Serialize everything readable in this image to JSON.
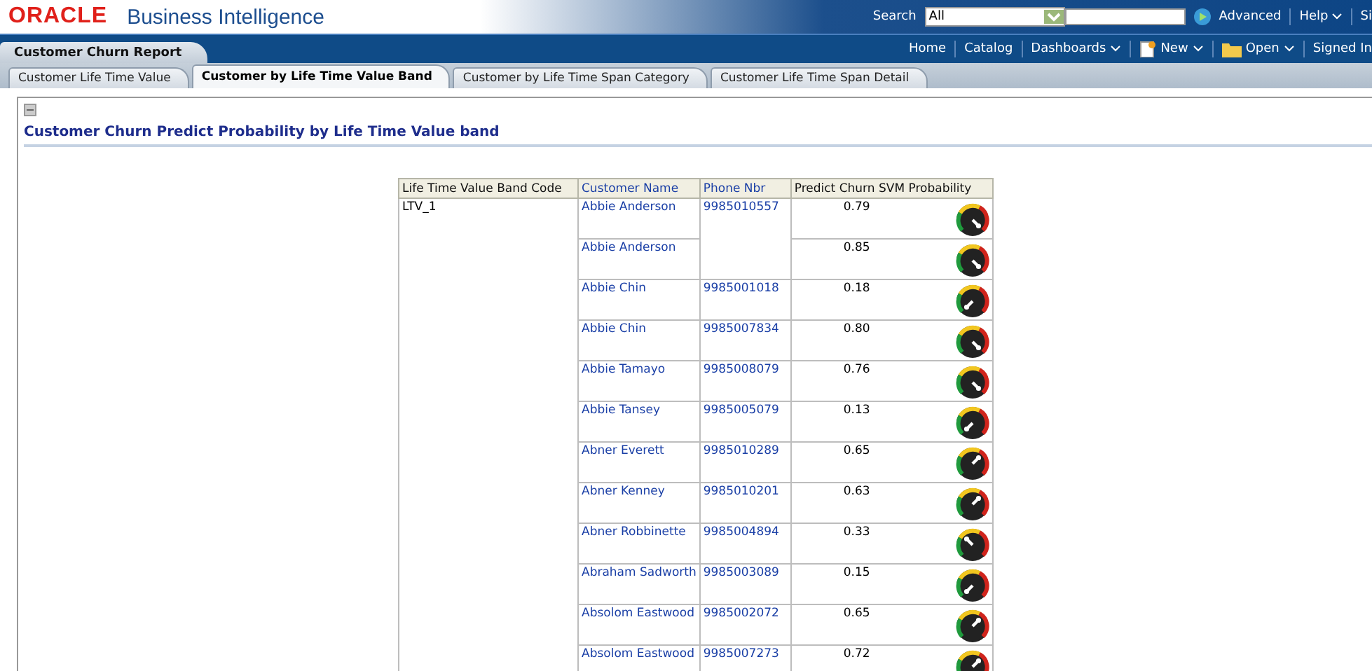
{
  "brand": {
    "logo": "ORACLE",
    "product": "Business Intelligence"
  },
  "search": {
    "label": "Search",
    "scope": "All",
    "go": "Advanced"
  },
  "top_links": [
    "Help",
    "Si"
  ],
  "dashboard": {
    "title": "Customer Churn Report"
  },
  "nav": [
    {
      "label": "Home",
      "menu": false,
      "kind": "link"
    },
    {
      "label": "Catalog",
      "menu": false,
      "kind": "link"
    },
    {
      "label": "Dashboards",
      "menu": true,
      "kind": "link"
    },
    {
      "label": "New",
      "menu": true,
      "kind": "new"
    },
    {
      "label": "Open",
      "menu": true,
      "kind": "folder"
    },
    {
      "label": "Signed In",
      "menu": false,
      "kind": "link"
    }
  ],
  "tabs": [
    {
      "label": "Customer Life Time Value",
      "selected": false
    },
    {
      "label": "Customer by Life Time Value Band",
      "selected": true
    },
    {
      "label": "Customer by Life Time Span Category",
      "selected": false
    },
    {
      "label": "Customer Life Time Span Detail",
      "selected": false
    }
  ],
  "section": {
    "title": "Customer Churn Predict Probability by Life Time Value band",
    "expanded": true
  },
  "table": {
    "columns": [
      "Life Time Value Band Code",
      "Customer Name",
      "Phone Nbr",
      "Predict Churn SVM Probability"
    ],
    "band": "LTV_1",
    "rows": [
      {
        "name": "Abbie Anderson",
        "phone": "9985010557",
        "prob": "0.79",
        "kind": "southeast"
      },
      {
        "name": "Abbie Anderson",
        "prob": "0.85",
        "kind": "southeast"
      },
      {
        "name": "Abbie Chin",
        "phone": "9985001018",
        "prob": "0.18",
        "kind": "southwest"
      },
      {
        "name": "Abbie Chin",
        "phone": "9985007834",
        "prob": "0.80",
        "kind": "southeast"
      },
      {
        "name": "Abbie Tamayo",
        "phone": "9985008079",
        "prob": "0.76",
        "kind": "southeast"
      },
      {
        "name": "Abbie Tansey",
        "phone": "9985005079",
        "prob": "0.13",
        "kind": "southwest"
      },
      {
        "name": "Abner Everett",
        "phone": "9985010289",
        "prob": "0.65",
        "kind": "northeast"
      },
      {
        "name": "Abner Kenney",
        "phone": "9985010201",
        "prob": "0.63",
        "kind": "northeast"
      },
      {
        "name": "Abner Robbinette",
        "phone": "9985004894",
        "prob": "0.33",
        "kind": "northwest"
      },
      {
        "name": "Abraham Sadworth",
        "phone": "9985003089",
        "prob": "0.15",
        "kind": "southwest"
      },
      {
        "name": "Absolom Eastwood",
        "phone": "9985002072",
        "prob": "0.65",
        "kind": "northeast"
      },
      {
        "name": "Absolom Eastwood",
        "phone": "9985007273",
        "prob": "0.72",
        "kind": "northeast"
      }
    ]
  }
}
